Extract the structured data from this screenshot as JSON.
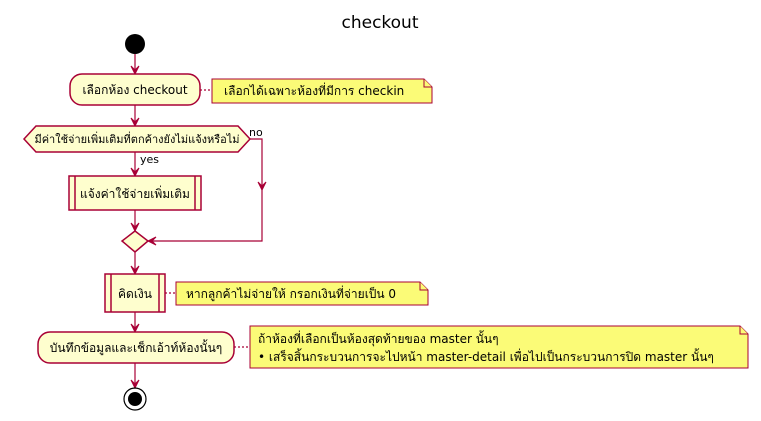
{
  "diagram": {
    "title": "checkout",
    "colors": {
      "activity_fill": "#FEFECE",
      "border": "#A80036",
      "note_fill": "#FBFB77",
      "start_end": "#000000"
    },
    "activities": {
      "select_room": "เลือกห้อง checkout",
      "notify_expense": "แจ้งค่าใช้จ่ายเพิ่มเติม",
      "calculate": "คิดเงิน",
      "save_checkout": "บันทึกข้อมูลและเช็กเอ้าท์ห้องนั้นๆ"
    },
    "decision": {
      "question": "มีค่าใช้จ่ายเพิ่มเติมที่ตกค้างยังไม่แจ้งหรือไม่",
      "yes_label": "yes",
      "no_label": "no"
    },
    "notes": {
      "select_room_note": "เลือกได้เฉพาะห้องที่มีการ checkin",
      "calculate_note": "หากลูกค้าไม่จ่ายให้ กรอกเงินที่จ่ายเป็น 0",
      "save_note_line1": "ถ้าห้องที่เลือกเป็นห้องสุดท้ายของ master นั้นๆ",
      "save_note_line2": "• เสร็จสิ้นกระบวนการจะไปหน้า master-detail เพื่อไปเป็นกระบวนการปิด master นั้นๆ"
    }
  }
}
